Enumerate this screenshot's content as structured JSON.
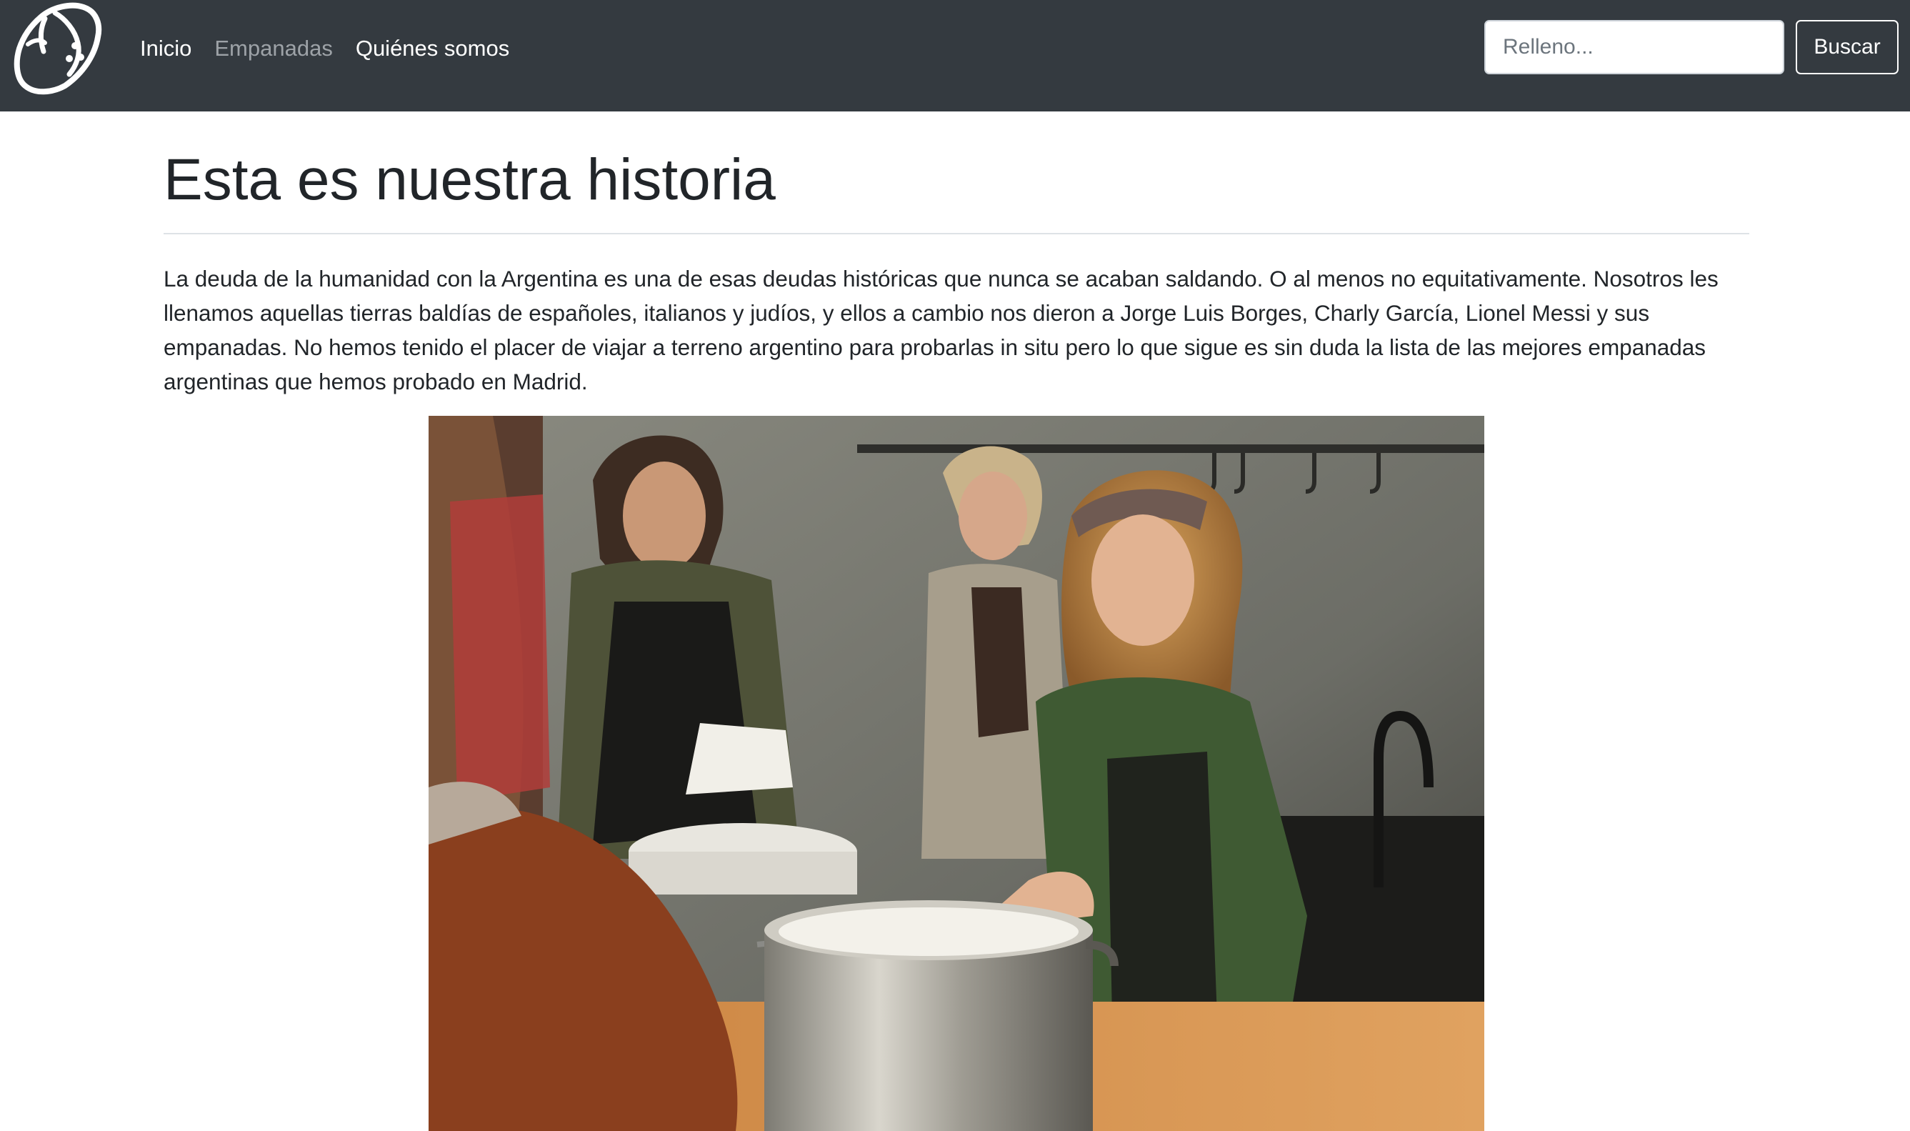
{
  "nav": {
    "logo": "empanada-logo",
    "links": [
      {
        "label": "Inicio",
        "active": false
      },
      {
        "label": "Empanadas",
        "active": true
      },
      {
        "label": "Quiénes somos",
        "active": false
      }
    ],
    "search": {
      "placeholder": "Relleno...",
      "value": "",
      "button_label": "Buscar"
    }
  },
  "main": {
    "title": "Esta es nuestra historia",
    "intro": "La deuda de la humanidad con la Argentina es una de esas deudas históricas que nunca se acaban saldando. O al menos no equitativamente. Nosotros les llenamos aquellas tierras baldías de españoles, italianos y judíos, y ellos a cambio nos dieron a Jorge Luis Borges, Charly García, Lionel Messi y sus empanadas. No hemos tenido el placer de viajar a terreno argentino para probarlas in situ pero lo que sigue es sin duda la lista de las mejores empanadas argentinas que hemos probado en Madrid."
  },
  "colors": {
    "navbar": "#343a40",
    "nav_link": "#ffffff",
    "nav_link_active": "#9da2a7",
    "divider": "#dee2e6"
  }
}
